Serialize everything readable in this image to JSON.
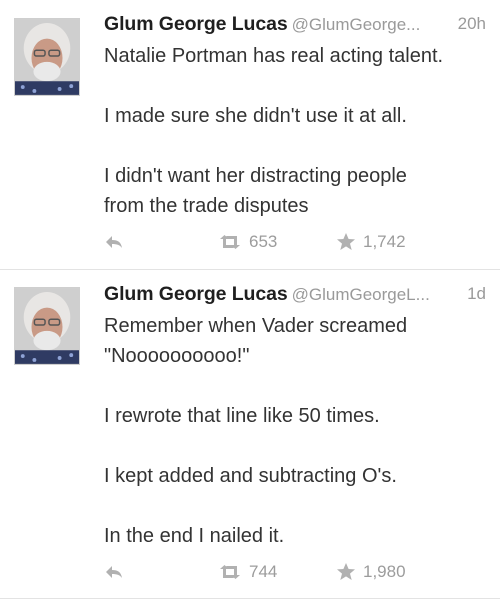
{
  "tweets": [
    {
      "author_name": "Glum George Lucas",
      "handle": "@GlumGeorge...",
      "time": "20h",
      "lines": [
        "Natalie Portman has real acting talent.",
        "",
        "I made sure she didn't use it at all.",
        "",
        "I didn't want her distracting people",
        "from the trade disputes"
      ],
      "retweets": "653",
      "favorites": "1,742"
    },
    {
      "author_name": "Glum George Lucas",
      "handle": "@GlumGeorgeL...",
      "time": "1d",
      "lines": [
        "Remember when Vader screamed",
        "\"Noooooooooo!\"",
        "",
        "I rewrote that line like 50 times.",
        "",
        "I kept added and subtracting O's.",
        "",
        "In the end I nailed it."
      ],
      "retweets": "744",
      "favorites": "1,980"
    }
  ],
  "icons": {
    "reply": "reply-icon",
    "retweet": "retweet-icon",
    "favorite": "star-icon"
  },
  "colors": {
    "name": "#1f1f1f",
    "meta": "#9a9a9a",
    "text": "#333333",
    "action": "#a3a3a3",
    "divider": "#e3e3e3"
  }
}
